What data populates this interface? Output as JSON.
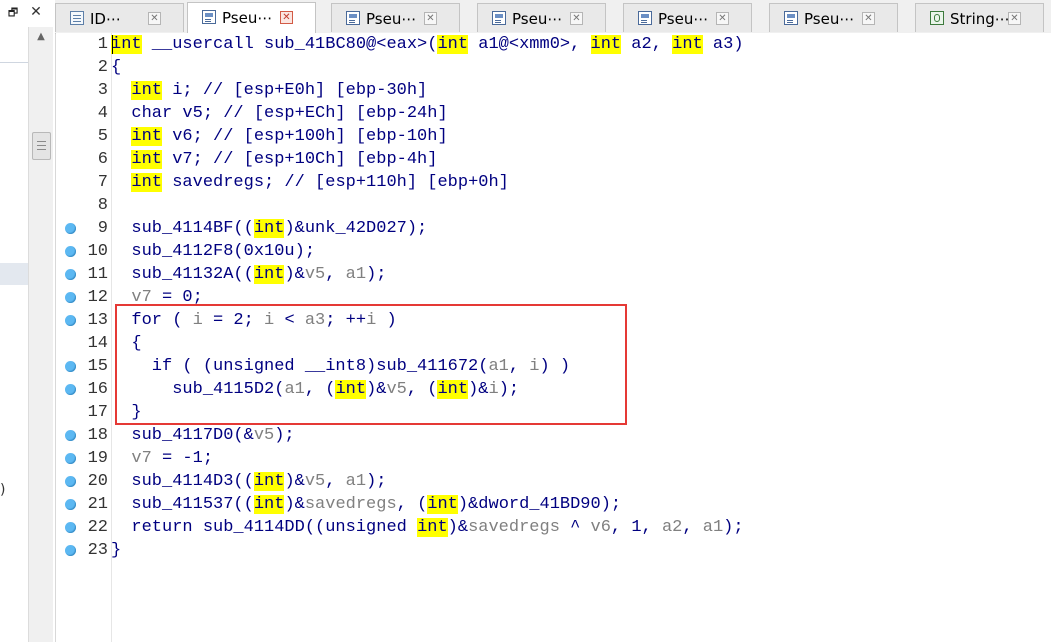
{
  "window": {
    "restore_glyph": "🗗",
    "close_glyph": "✕"
  },
  "tabs": [
    {
      "label": "ID⋯",
      "icon": "document-icon",
      "active": false
    },
    {
      "label": "Pseu⋯",
      "icon": "pseudocode-icon",
      "active": true
    },
    {
      "label": "Pseu⋯",
      "icon": "pseudocode-icon",
      "active": false
    },
    {
      "label": "Pseu⋯",
      "icon": "pseudocode-icon",
      "active": false
    },
    {
      "label": "Pseu⋯",
      "icon": "pseudocode-icon",
      "active": false
    },
    {
      "label": "Pseu⋯",
      "icon": "pseudocode-icon",
      "active": false
    },
    {
      "label": "String⋯",
      "icon": "strings-icon",
      "active": false
    }
  ],
  "tab_close_glyph": "✕",
  "left_marker": ")",
  "colors": {
    "keyword_highlight": "#ffff00",
    "code_text": "#000080",
    "variable_text": "#808080",
    "breakpoint": "#5cb8f2",
    "selection_box": "#e53935"
  },
  "code": {
    "lines": [
      {
        "n": "1",
        "bp": false,
        "segs": [
          [
            "int",
            "k"
          ],
          [
            " __usercall sub_41BC80@<eax>(",
            ""
          ],
          [
            "int",
            "k"
          ],
          [
            " a1@<xmm0>, ",
            ""
          ],
          [
            "int",
            "k"
          ],
          [
            " a2, ",
            ""
          ],
          [
            "int",
            "k"
          ],
          [
            " a3)",
            ""
          ]
        ]
      },
      {
        "n": "2",
        "bp": false,
        "segs": [
          [
            "{",
            ""
          ]
        ]
      },
      {
        "n": "3",
        "bp": false,
        "segs": [
          [
            "  ",
            ""
          ],
          [
            "int",
            "k"
          ],
          [
            " i; // [esp+E0h] [ebp-30h]",
            ""
          ]
        ]
      },
      {
        "n": "4",
        "bp": false,
        "segs": [
          [
            "  char v5; // [esp+ECh] [ebp-24h]",
            ""
          ]
        ]
      },
      {
        "n": "5",
        "bp": false,
        "segs": [
          [
            "  ",
            ""
          ],
          [
            "int",
            "k"
          ],
          [
            " v6; // [esp+100h] [ebp-10h]",
            ""
          ]
        ]
      },
      {
        "n": "6",
        "bp": false,
        "segs": [
          [
            "  ",
            ""
          ],
          [
            "int",
            "k"
          ],
          [
            " v7; // [esp+10Ch] [ebp-4h]",
            ""
          ]
        ]
      },
      {
        "n": "7",
        "bp": false,
        "segs": [
          [
            "  ",
            ""
          ],
          [
            "int",
            "k"
          ],
          [
            " savedregs; // [esp+110h] [ebp+0h]",
            ""
          ]
        ]
      },
      {
        "n": "8",
        "bp": false,
        "segs": [
          [
            "",
            ""
          ]
        ]
      },
      {
        "n": "9",
        "bp": true,
        "segs": [
          [
            "  sub_4114BF((",
            ""
          ],
          [
            "int",
            "k"
          ],
          [
            ")&unk_42D027);",
            ""
          ]
        ]
      },
      {
        "n": "10",
        "bp": true,
        "segs": [
          [
            "  sub_4112F8(0x10u);",
            ""
          ]
        ]
      },
      {
        "n": "11",
        "bp": true,
        "segs": [
          [
            "  sub_41132A((",
            ""
          ],
          [
            "int",
            "k"
          ],
          [
            ")&",
            ""
          ],
          [
            "v5",
            "v"
          ],
          [
            ", ",
            ""
          ],
          [
            "a1",
            "v"
          ],
          [
            ");",
            ""
          ]
        ]
      },
      {
        "n": "12",
        "bp": true,
        "segs": [
          [
            "  ",
            ""
          ],
          [
            "v7",
            "v"
          ],
          [
            " = 0;",
            ""
          ]
        ]
      },
      {
        "n": "13",
        "bp": true,
        "segs": [
          [
            "  for ( ",
            ""
          ],
          [
            "i",
            "v"
          ],
          [
            " = 2; ",
            ""
          ],
          [
            "i",
            "v"
          ],
          [
            " < ",
            ""
          ],
          [
            "a3",
            "v"
          ],
          [
            "; ++",
            ""
          ],
          [
            "i",
            "v"
          ],
          [
            " )",
            ""
          ]
        ]
      },
      {
        "n": "14",
        "bp": false,
        "segs": [
          [
            "  {",
            ""
          ]
        ]
      },
      {
        "n": "15",
        "bp": true,
        "segs": [
          [
            "    if ( (unsigned __int8)sub_411672(",
            ""
          ],
          [
            "a1",
            "v"
          ],
          [
            ", ",
            ""
          ],
          [
            "i",
            "v"
          ],
          [
            ") )",
            ""
          ]
        ]
      },
      {
        "n": "16",
        "bp": true,
        "segs": [
          [
            "      sub_4115D2(",
            ""
          ],
          [
            "a1",
            "v"
          ],
          [
            ", (",
            ""
          ],
          [
            "int",
            "k"
          ],
          [
            ")&",
            ""
          ],
          [
            "v5",
            "v"
          ],
          [
            ", (",
            ""
          ],
          [
            "int",
            "k"
          ],
          [
            ")&",
            ""
          ],
          [
            "i",
            "v"
          ],
          [
            ");",
            ""
          ]
        ]
      },
      {
        "n": "17",
        "bp": false,
        "segs": [
          [
            "  }",
            ""
          ]
        ]
      },
      {
        "n": "18",
        "bp": true,
        "segs": [
          [
            "  sub_4117D0(&",
            ""
          ],
          [
            "v5",
            "v"
          ],
          [
            ");",
            ""
          ]
        ]
      },
      {
        "n": "19",
        "bp": true,
        "segs": [
          [
            "  ",
            ""
          ],
          [
            "v7",
            "v"
          ],
          [
            " = -1;",
            ""
          ]
        ]
      },
      {
        "n": "20",
        "bp": true,
        "segs": [
          [
            "  sub_4114D3((",
            ""
          ],
          [
            "int",
            "k"
          ],
          [
            ")&",
            ""
          ],
          [
            "v5",
            "v"
          ],
          [
            ", ",
            ""
          ],
          [
            "a1",
            "v"
          ],
          [
            ");",
            ""
          ]
        ]
      },
      {
        "n": "21",
        "bp": true,
        "segs": [
          [
            "  sub_411537((",
            ""
          ],
          [
            "int",
            "k"
          ],
          [
            ")&",
            ""
          ],
          [
            "savedregs",
            "v"
          ],
          [
            ", (",
            ""
          ],
          [
            "int",
            "k"
          ],
          [
            ")&dword_41BD90);",
            ""
          ]
        ]
      },
      {
        "n": "22",
        "bp": true,
        "segs": [
          [
            "  return sub_4114DD((unsigned ",
            ""
          ],
          [
            "int",
            "k"
          ],
          [
            ")&",
            ""
          ],
          [
            "savedregs",
            "v"
          ],
          [
            " ^ ",
            ""
          ],
          [
            "v6",
            "v"
          ],
          [
            ", 1, ",
            ""
          ],
          [
            "a2",
            "v"
          ],
          [
            ", ",
            ""
          ],
          [
            "a1",
            "v"
          ],
          [
            ");",
            ""
          ]
        ]
      },
      {
        "n": "23",
        "bp": true,
        "segs": [
          [
            "}",
            ""
          ]
        ]
      }
    ]
  }
}
